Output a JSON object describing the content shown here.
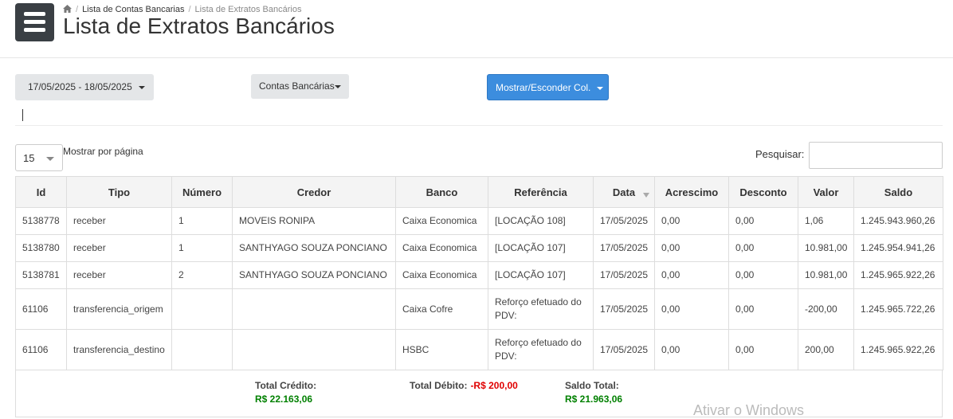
{
  "breadcrumb": {
    "items": [
      "Lista de Contas Bancarias",
      "Lista de Extratos Bancários"
    ]
  },
  "page_title": "Lista de Extratos Bancários",
  "filters": {
    "date_range": "17/05/2025 - 18/05/2025",
    "contas_label": "Contas Bancárias",
    "columns_label": "Mostrar/Esconder Col."
  },
  "per_page": {
    "value": "15",
    "label": "Mostrar por página"
  },
  "search": {
    "label": "Pesquisar:",
    "value": ""
  },
  "table": {
    "headers": [
      "Id",
      "Tipo",
      "Número",
      "Credor",
      "Banco",
      "Referência",
      "Data",
      "Acrescimo",
      "Desconto",
      "Valor",
      "Saldo"
    ],
    "rows": [
      [
        "5138778",
        "receber",
        "1",
        "MOVEIS RONIPA",
        "Caixa Economica",
        "[LOCAÇÃO 108]",
        "17/05/2025",
        "0,00",
        "0,00",
        "1,06",
        "1.245.943.960,26"
      ],
      [
        "5138780",
        "receber",
        "1",
        "SANTHYAGO SOUZA PONCIANO",
        "Caixa Economica",
        "[LOCAÇÃO 107]",
        "17/05/2025",
        "0,00",
        "0,00",
        "10.981,00",
        "1.245.954.941,26"
      ],
      [
        "5138781",
        "receber",
        "2",
        "SANTHYAGO SOUZA PONCIANO",
        "Caixa Economica",
        "[LOCAÇÃO 107]",
        "17/05/2025",
        "0,00",
        "0,00",
        "10.981,00",
        "1.245.965.922,26"
      ],
      [
        "61106",
        "transferencia_origem",
        "",
        "",
        "Caixa Cofre",
        "Reforço efetuado do PDV:",
        "17/05/2025",
        "0,00",
        "0,00",
        "-200,00",
        "1.245.965.722,26"
      ],
      [
        "61106",
        "transferencia_destino",
        "",
        "",
        "HSBC",
        "Reforço efetuado do PDV:",
        "17/05/2025",
        "0,00",
        "0,00",
        "200,00",
        "1.245.965.922,26"
      ]
    ]
  },
  "totals": {
    "credito_label": "Total Crédito:",
    "credito_value": "R$ 22.163,06",
    "debito_label": "Total Débito:",
    "debito_value": "-R$ 200,00",
    "saldo_label": "Saldo Total:",
    "saldo_value": "R$ 21.963,06"
  },
  "watermark": "Ativar o Windows",
  "colors": {
    "primary": "#3c8dde",
    "positive": "#008000",
    "negative": "#e00000",
    "menu_bg": "#3a3f44"
  }
}
